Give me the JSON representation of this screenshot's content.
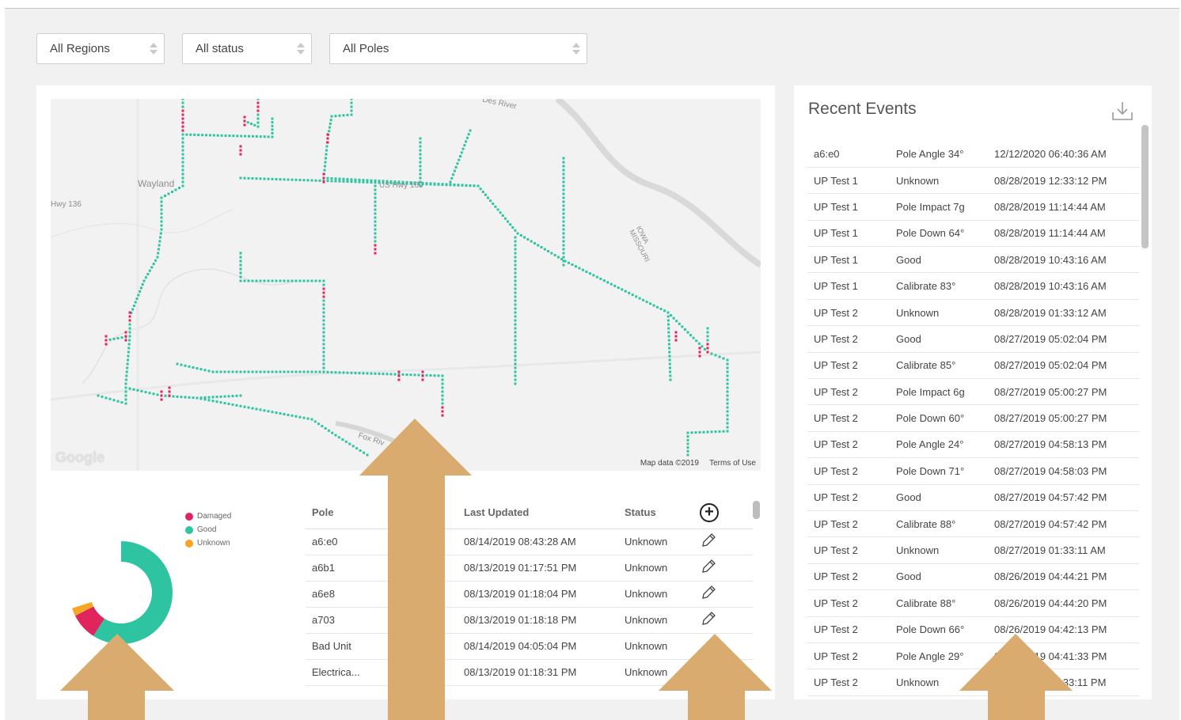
{
  "filters": [
    {
      "value": "All Regions"
    },
    {
      "value": "All status"
    },
    {
      "value": "All Poles"
    }
  ],
  "map": {
    "labels": [
      "Wayland",
      "Hwy 136",
      "US Hwy 160",
      "IOWA MISSOURI",
      "Des River",
      "Fox Riv"
    ],
    "logo": "Google",
    "attribution": "Map data ©2019",
    "terms": "Terms of Use",
    "colors": {
      "good": "#2ec4a1",
      "damaged": "#e0245e",
      "unknown": "#f5a623"
    }
  },
  "legend": [
    {
      "label": "Damaged",
      "color": "#e0245e"
    },
    {
      "label": "Good",
      "color": "#2ec4a1"
    },
    {
      "label": "Unknown",
      "color": "#f5a623"
    }
  ],
  "donut": {
    "good": 0.89,
    "damaged": 0.085,
    "unknown": 0.025
  },
  "pole_table": {
    "headers": [
      "Pole",
      "Last Updated",
      "Status"
    ],
    "rows": [
      [
        "a6:e0",
        "08/14/2019 08:43:28 AM",
        "Unknown"
      ],
      [
        "a6b1",
        "08/13/2019 01:17:51 PM",
        "Unknown"
      ],
      [
        "a6e8",
        "08/13/2019 01:18:04 PM",
        "Unknown"
      ],
      [
        "a703",
        "08/13/2019 01:18:18 PM",
        "Unknown"
      ],
      [
        "Bad Unit",
        "08/14/2019 04:05:04 PM",
        "Unknown"
      ],
      [
        "Electrica...",
        "08/13/2019 01:18:31 PM",
        "Unknown"
      ]
    ]
  },
  "events": {
    "title": "Recent Events",
    "rows": [
      [
        "a6:e0",
        "Pole Angle 34°",
        "12/12/2020 06:40:36 AM"
      ],
      [
        "UP Test 1",
        "Unknown",
        "08/28/2019 12:33:12 PM"
      ],
      [
        "UP Test 1",
        "Pole Impact 7g",
        "08/28/2019 11:14:44 AM"
      ],
      [
        "UP Test 1",
        "Pole Down 64°",
        "08/28/2019 11:14:44 AM"
      ],
      [
        "UP Test 1",
        "Good",
        "08/28/2019 10:43:16 AM"
      ],
      [
        "UP Test 1",
        "Calibrate 83°",
        "08/28/2019 10:43:16 AM"
      ],
      [
        "UP Test 2",
        "Unknown",
        "08/28/2019 01:33:12 AM"
      ],
      [
        "UP Test 2",
        "Good",
        "08/27/2019 05:02:04 PM"
      ],
      [
        "UP Test 2",
        "Calibrate 85°",
        "08/27/2019 05:02:04 PM"
      ],
      [
        "UP Test 2",
        "Pole Impact 6g",
        "08/27/2019 05:00:27 PM"
      ],
      [
        "UP Test 2",
        "Pole Down 60°",
        "08/27/2019 05:00:27 PM"
      ],
      [
        "UP Test 2",
        "Pole Angle 24°",
        "08/27/2019 04:58:13 PM"
      ],
      [
        "UP Test 2",
        "Pole Down 71°",
        "08/27/2019 04:58:03 PM"
      ],
      [
        "UP Test 2",
        "Good",
        "08/27/2019 04:57:42 PM"
      ],
      [
        "UP Test 2",
        "Calibrate 88°",
        "08/27/2019 04:57:42 PM"
      ],
      [
        "UP Test 2",
        "Unknown",
        "08/27/2019 01:33:11 AM"
      ],
      [
        "UP Test 2",
        "Good",
        "08/26/2019 04:44:21 PM"
      ],
      [
        "UP Test 2",
        "Calibrate 88°",
        "08/26/2019 04:44:20 PM"
      ],
      [
        "UP Test 2",
        "Pole Down 66°",
        "08/26/2019 04:42:13 PM"
      ],
      [
        "UP Test 2",
        "Pole Angle 29°",
        "08/26/2019 04:41:33 PM"
      ],
      [
        "UP Test 2",
        "Unknown",
        "08/26/2019 01:33:11 PM"
      ]
    ]
  },
  "icons": {
    "add": "add-circle-icon",
    "edit": "pencil-icon",
    "download": "download-icon"
  },
  "overlay": {
    "arrow_color": "#d9ab6e"
  }
}
